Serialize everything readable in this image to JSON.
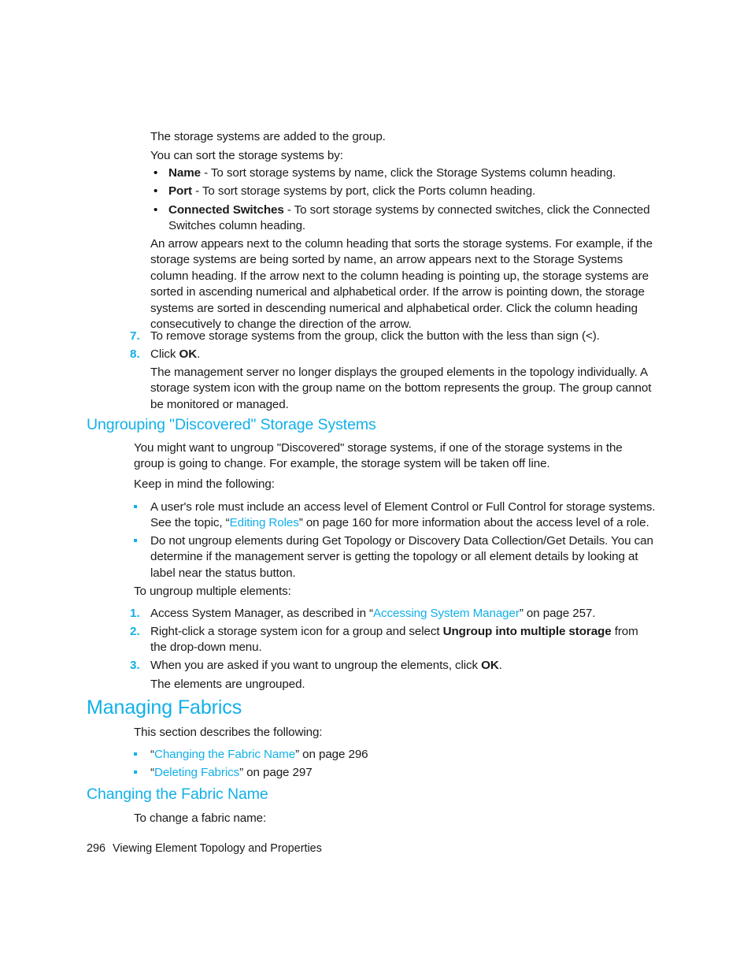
{
  "document": {
    "page_number": "296",
    "footer_title": "Viewing Element Topology and Properties",
    "accent_color": "#12b0e8",
    "text_color": "#1a1a1a"
  },
  "blocks": {
    "p_added": "The storage systems are added to the group.",
    "p_sort_intro": "You can sort the storage systems by:",
    "sort_options": [
      {
        "term": "Name",
        "sep": " - ",
        "text": "To sort storage systems by name, click the Storage Systems column heading."
      },
      {
        "term": "Port",
        "sep": " - ",
        "text": "To sort storage systems by port, click the Ports column heading."
      },
      {
        "term": "Connected Switches",
        "sep": " - ",
        "text": "To sort storage systems by connected switches, click the Connected Switches column heading."
      }
    ],
    "p_arrow": "An arrow appears next to the column heading that sorts the storage systems. For example, if the storage systems are being sorted by name, an arrow appears next to the Storage Systems column heading. If the arrow next to the column heading is pointing up, the storage systems are sorted in ascending numerical and alphabetical order. If the arrow is pointing down, the storage systems are sorted in descending numerical and alphabetical order. Click the column heading consecutively to change the direction of the arrow.",
    "step7": {
      "marker": "7.",
      "text": "To remove storage systems from the group, click the button with the less than sign (<)."
    },
    "step8": {
      "marker": "8.",
      "text_before": "Click ",
      "bold": "OK",
      "text_after": "."
    },
    "p_mgmt_server": "The management server no longer displays the grouped elements in the topology individually. A storage system icon with the group name on the bottom represents the group. The group cannot be monitored or managed.",
    "h_ungrouping": "Ungrouping \"Discovered\" Storage Systems",
    "p_ungroup_intro": "You might want to ungroup \"Discovered\" storage systems, if one of the storage systems in the group is going to change. For example, the storage system will be taken off line.",
    "p_keep_in_mind": "Keep in mind the following:",
    "keep_bullets": [
      {
        "text_before": "A user's role must include an access level of Element Control or Full Control for storage systems. See the topic, “",
        "link": "Editing Roles",
        "text_after": "” on page 160 for more information about the access level of a role."
      },
      {
        "text_before": "Do not ungroup elements during Get Topology or Discovery Data Collection/Get Details. You can determine if the management server is getting the topology or all element details by looking at label near the status button.",
        "link": "",
        "text_after": ""
      }
    ],
    "p_to_ungroup": "To ungroup multiple elements:",
    "ungroup_steps": [
      {
        "marker": "1.",
        "text_before": "Access System Manager, as described in “",
        "link": "Accessing System Manager",
        "text_after": "” on page 257."
      },
      {
        "marker": "2.",
        "text_before": "Right-click a storage system icon for a group and select ",
        "bold": "Ungroup into multiple storage",
        "text_after": " from the drop-down menu."
      },
      {
        "marker": "3.",
        "text_before": "When you are asked if you want to ungroup the elements, click ",
        "bold": "OK",
        "text_after": "."
      }
    ],
    "p_elements_ungrouped": "The elements are ungrouped.",
    "h_managing_fabrics": "Managing Fabrics",
    "p_section_describes": "This section describes the following:",
    "fabric_links": [
      {
        "quote_open": "“",
        "link": "Changing the Fabric Name",
        "after": "” on page 296"
      },
      {
        "quote_open": "“",
        "link": "Deleting Fabrics",
        "after": "” on page 297"
      }
    ],
    "h_changing_fabric": "Changing the Fabric Name",
    "p_to_change": "To change a fabric name:"
  }
}
